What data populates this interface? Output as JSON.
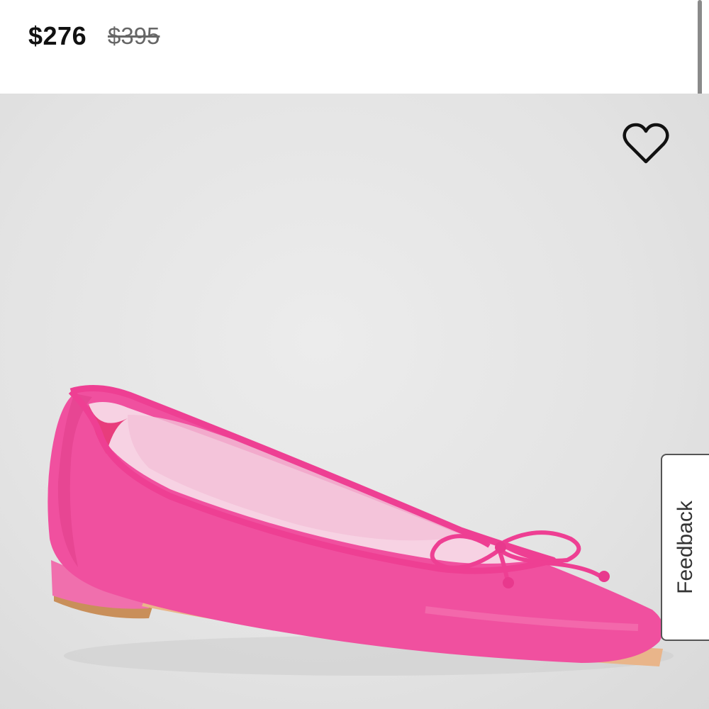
{
  "price": {
    "current": "$276",
    "original": "$395"
  },
  "product": {
    "image_icon": "pink-ballet-flat-shoe",
    "shoe_color": "#f0509f",
    "background_color": "#e4e4e4"
  },
  "wishlist": {
    "icon": "heart-outline-icon"
  },
  "feedback": {
    "label": "Feedback"
  }
}
